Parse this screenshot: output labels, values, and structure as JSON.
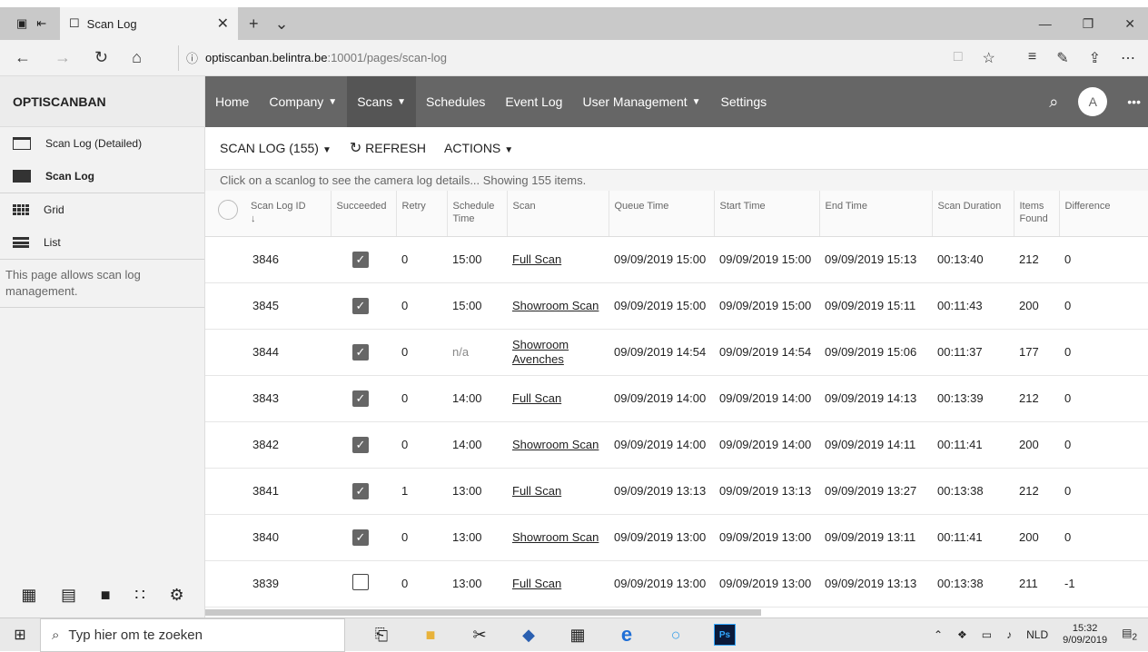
{
  "browser": {
    "tab_title": "Scan Log",
    "url_host": "optiscanban.belintra.be",
    "url_path": ":10001/pages/scan-log"
  },
  "sidebar": {
    "brand": "OPTISCANBAN",
    "items": [
      {
        "label": "Scan Log (Detailed)",
        "icon": "folder-outline-icon"
      },
      {
        "label": "Scan Log",
        "icon": "folder-icon"
      },
      {
        "label": "Grid",
        "icon": "grid-icon"
      },
      {
        "label": "List",
        "icon": "list-icon"
      }
    ],
    "description": "This page allows scan log management."
  },
  "nav": {
    "items": [
      {
        "label": "Home"
      },
      {
        "label": "Company"
      },
      {
        "label": "Scans"
      },
      {
        "label": "Schedules"
      },
      {
        "label": "Event Log"
      },
      {
        "label": "User Management"
      },
      {
        "label": "Settings"
      }
    ],
    "avatar": "A"
  },
  "toolbar": {
    "scanlog_label": "SCAN LOG (155)",
    "refresh_label": "REFRESH",
    "actions_label": "ACTIONS"
  },
  "info_text": "Click on a scanlog to see the camera log details... Showing 155 items.",
  "table": {
    "headers": [
      "Scan Log ID",
      "Succeeded",
      "Retry",
      "Schedule Time",
      "Scan",
      "Queue Time",
      "Start Time",
      "End Time",
      "Scan Duration",
      "Items Found",
      "Difference"
    ],
    "rows": [
      {
        "id": "3846",
        "succeeded": true,
        "retry": "0",
        "schedule": "15:00",
        "scan": "Full Scan",
        "queue": "09/09/2019 15:00",
        "start": "09/09/2019 15:00",
        "end": "09/09/2019 15:13",
        "duration": "00:13:40",
        "items": "212",
        "diff": "0"
      },
      {
        "id": "3845",
        "succeeded": true,
        "retry": "0",
        "schedule": "15:00",
        "scan": "Showroom Scan",
        "queue": "09/09/2019 15:00",
        "start": "09/09/2019 15:00",
        "end": "09/09/2019 15:11",
        "duration": "00:11:43",
        "items": "200",
        "diff": "0"
      },
      {
        "id": "3844",
        "succeeded": true,
        "retry": "0",
        "schedule": "n/a",
        "scan": "Showroom Avenches",
        "queue": "09/09/2019 14:54",
        "start": "09/09/2019 14:54",
        "end": "09/09/2019 15:06",
        "duration": "00:11:37",
        "items": "177",
        "diff": "0"
      },
      {
        "id": "3843",
        "succeeded": true,
        "retry": "0",
        "schedule": "14:00",
        "scan": "Full Scan",
        "queue": "09/09/2019 14:00",
        "start": "09/09/2019 14:00",
        "end": "09/09/2019 14:13",
        "duration": "00:13:39",
        "items": "212",
        "diff": "0"
      },
      {
        "id": "3842",
        "succeeded": true,
        "retry": "0",
        "schedule": "14:00",
        "scan": "Showroom Scan",
        "queue": "09/09/2019 14:00",
        "start": "09/09/2019 14:00",
        "end": "09/09/2019 14:11",
        "duration": "00:11:41",
        "items": "200",
        "diff": "0"
      },
      {
        "id": "3841",
        "succeeded": true,
        "retry": "1",
        "schedule": "13:00",
        "scan": "Full Scan",
        "queue": "09/09/2019 13:13",
        "start": "09/09/2019 13:13",
        "end": "09/09/2019 13:27",
        "duration": "00:13:38",
        "items": "212",
        "diff": "0"
      },
      {
        "id": "3840",
        "succeeded": true,
        "retry": "0",
        "schedule": "13:00",
        "scan": "Showroom Scan",
        "queue": "09/09/2019 13:00",
        "start": "09/09/2019 13:00",
        "end": "09/09/2019 13:11",
        "duration": "00:11:41",
        "items": "200",
        "diff": "0"
      },
      {
        "id": "3839",
        "succeeded": false,
        "retry": "0",
        "schedule": "13:00",
        "scan": "Full Scan",
        "queue": "09/09/2019 13:00",
        "start": "09/09/2019 13:00",
        "end": "09/09/2019 13:13",
        "duration": "00:13:38",
        "items": "211",
        "diff": "-1"
      }
    ]
  },
  "taskbar": {
    "search_placeholder": "Typ hier om te zoeken",
    "lang": "NLD",
    "time": "15:32",
    "date": "9/09/2019",
    "notification_count": "2"
  }
}
